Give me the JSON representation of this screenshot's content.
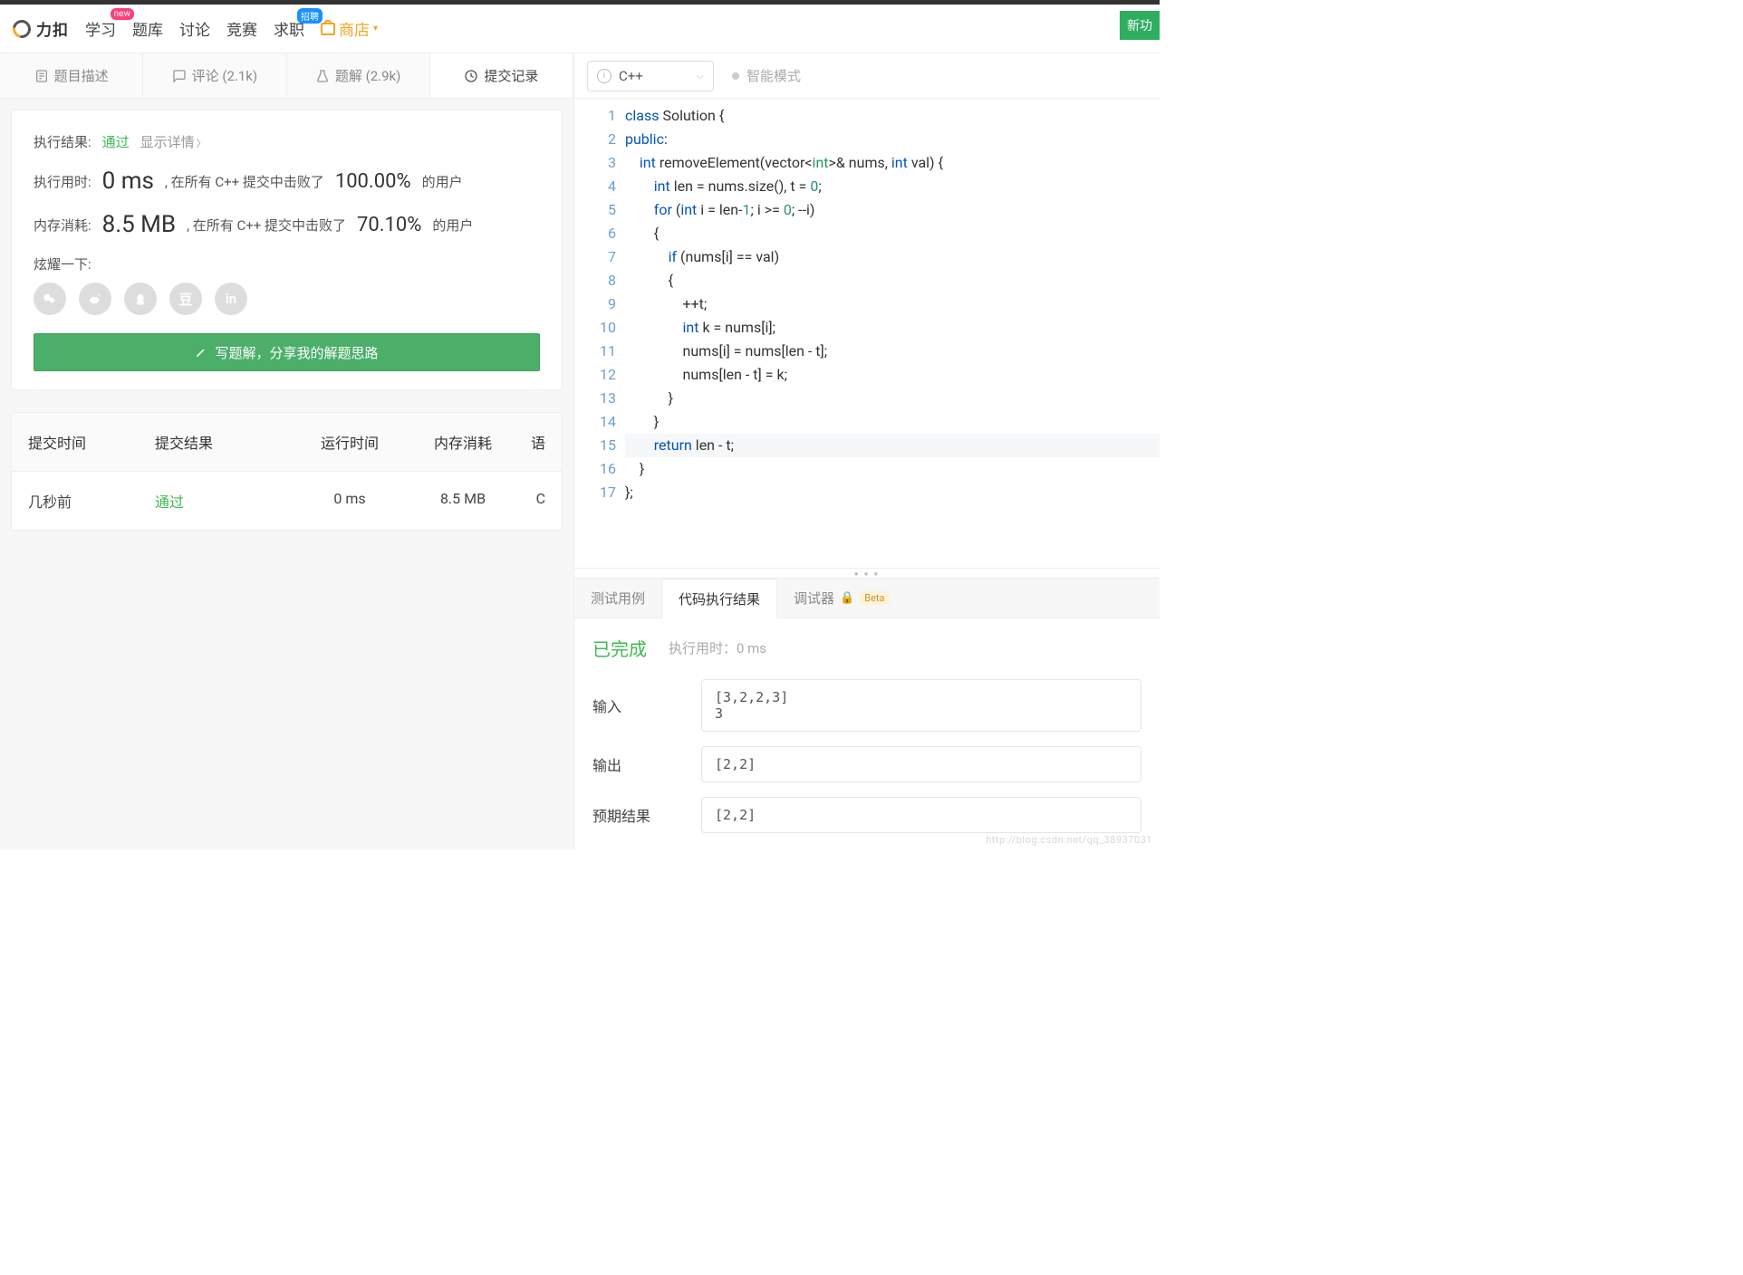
{
  "nav": {
    "brand": "力扣",
    "items": [
      "学习",
      "题库",
      "讨论",
      "竞赛",
      "求职"
    ],
    "badges": {
      "new": "new",
      "hire": "招聘"
    },
    "store": "商店",
    "newfeat": "新功"
  },
  "tabs": {
    "desc": "题目描述",
    "comments": "评论 (2.1k)",
    "solutions": "题解 (2.9k)",
    "submissions": "提交记录"
  },
  "result": {
    "label": "执行结果:",
    "status": "通过",
    "details": "显示详情",
    "runtime_lbl": "执行用时:",
    "runtime_val": "0 ms",
    "runtime_txt": ", 在所有 C++ 提交中击败了",
    "runtime_pct": "100.00%",
    "runtime_suffix": "的用户",
    "memory_lbl": "内存消耗:",
    "memory_val": "8.5 MB",
    "memory_txt": ", 在所有 C++ 提交中击败了",
    "memory_pct": "70.10%",
    "memory_suffix": "的用户",
    "share_lbl": "炫耀一下:",
    "write_btn": "写题解，分享我的解题思路"
  },
  "share_icons": [
    "wechat",
    "weibo",
    "qq",
    "douban",
    "linkedin"
  ],
  "table": {
    "headers": [
      "提交时间",
      "提交结果",
      "运行时间",
      "内存消耗",
      "语"
    ],
    "row": [
      "几秒前",
      "通过",
      "0 ms",
      "8.5 MB",
      "C"
    ]
  },
  "code_header": {
    "lang": "C++",
    "smart": "智能模式"
  },
  "code_lines": [
    {
      "n": 1,
      "h": "<span class='kw'>class</span> Solution {"
    },
    {
      "n": 2,
      "h": "<span class='kw'>public</span>:"
    },
    {
      "n": 3,
      "h": "    <span class='kw'>int</span> removeElement(vector&lt;<span class='ty'>int</span>&gt;&amp; nums, <span class='kw'>int</span> val) {"
    },
    {
      "n": 4,
      "h": "        <span class='kw'>int</span> len = nums.size(), t = <span class='num'>0</span>;"
    },
    {
      "n": 5,
      "h": "        <span class='kw'>for</span> (<span class='kw'>int</span> i = len-<span class='num'>1</span>; i &gt;= <span class='num'>0</span>; --i)"
    },
    {
      "n": 6,
      "h": "        {"
    },
    {
      "n": 7,
      "h": "            <span class='kw'>if</span> (nums[i] == val)"
    },
    {
      "n": 8,
      "h": "            {"
    },
    {
      "n": 9,
      "h": "                ++t;"
    },
    {
      "n": 10,
      "h": "                <span class='kw'>int</span> k = nums[i];"
    },
    {
      "n": 11,
      "h": "                nums[i] = nums[len - t];"
    },
    {
      "n": 12,
      "h": "                nums[len - t] = k;"
    },
    {
      "n": 13,
      "h": "            }"
    },
    {
      "n": 14,
      "h": "        }"
    },
    {
      "n": 15,
      "h": "        <span class='kw'>return</span> len - t;",
      "hl": true
    },
    {
      "n": 16,
      "h": "    }"
    },
    {
      "n": 17,
      "h": "};"
    }
  ],
  "bottom_tabs": {
    "test": "测试用例",
    "exec": "代码执行结果",
    "debug": "调试器",
    "beta": "Beta"
  },
  "exec": {
    "done": "已完成",
    "time": "执行用时：0 ms",
    "input_lbl": "输入",
    "input": "[3,2,2,3]\n3",
    "output_lbl": "输出",
    "output": "[2,2]",
    "expected_lbl": "预期结果",
    "expected": "[2,2]"
  },
  "watermark": "http://blog.csdn.net/qq_38937031"
}
